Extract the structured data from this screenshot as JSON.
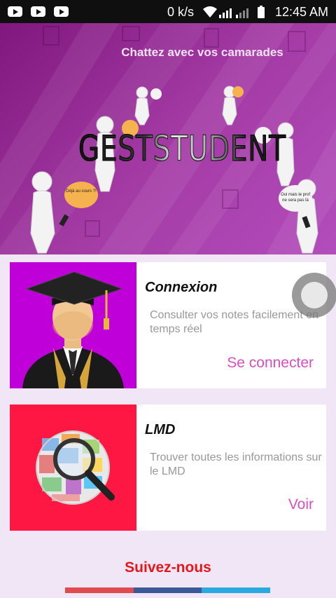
{
  "status_bar": {
    "notification_icons": [
      "youtube-icon",
      "youtube-icon",
      "youtube-icon"
    ],
    "network_speed": "0 k/s",
    "time": "12:45 AM",
    "status_icons": [
      "wifi-icon",
      "signal-icon",
      "signal-icon",
      "battery-icon"
    ]
  },
  "banner": {
    "caption": "Chattez avec vos camarades",
    "brand": "GESTSTUDENT",
    "bubble_left": "Déjà au cours ?!",
    "bubble_right": "Oui mais le prof ne sera pas là"
  },
  "cards": [
    {
      "title": "Connexion",
      "description": "Consulter vos notes facilement en temps réel",
      "action": "Se connecter",
      "image_color": "#c000d8",
      "image": "graduate-icon"
    },
    {
      "title": "LMD",
      "description": "Trouver toutes les informations sur le LMD",
      "action": "Voir",
      "image_color": "#ff1744",
      "image": "magnifier-globe-icon"
    }
  ],
  "footer": {
    "follow_label": "Suivez-nous",
    "social_colors": [
      "#e14a4f",
      "#3b5998",
      "#29a9e0"
    ]
  },
  "colors": {
    "accent": "#d84fbe",
    "follow": "#e5171c",
    "banner": "#9b2e9c"
  }
}
